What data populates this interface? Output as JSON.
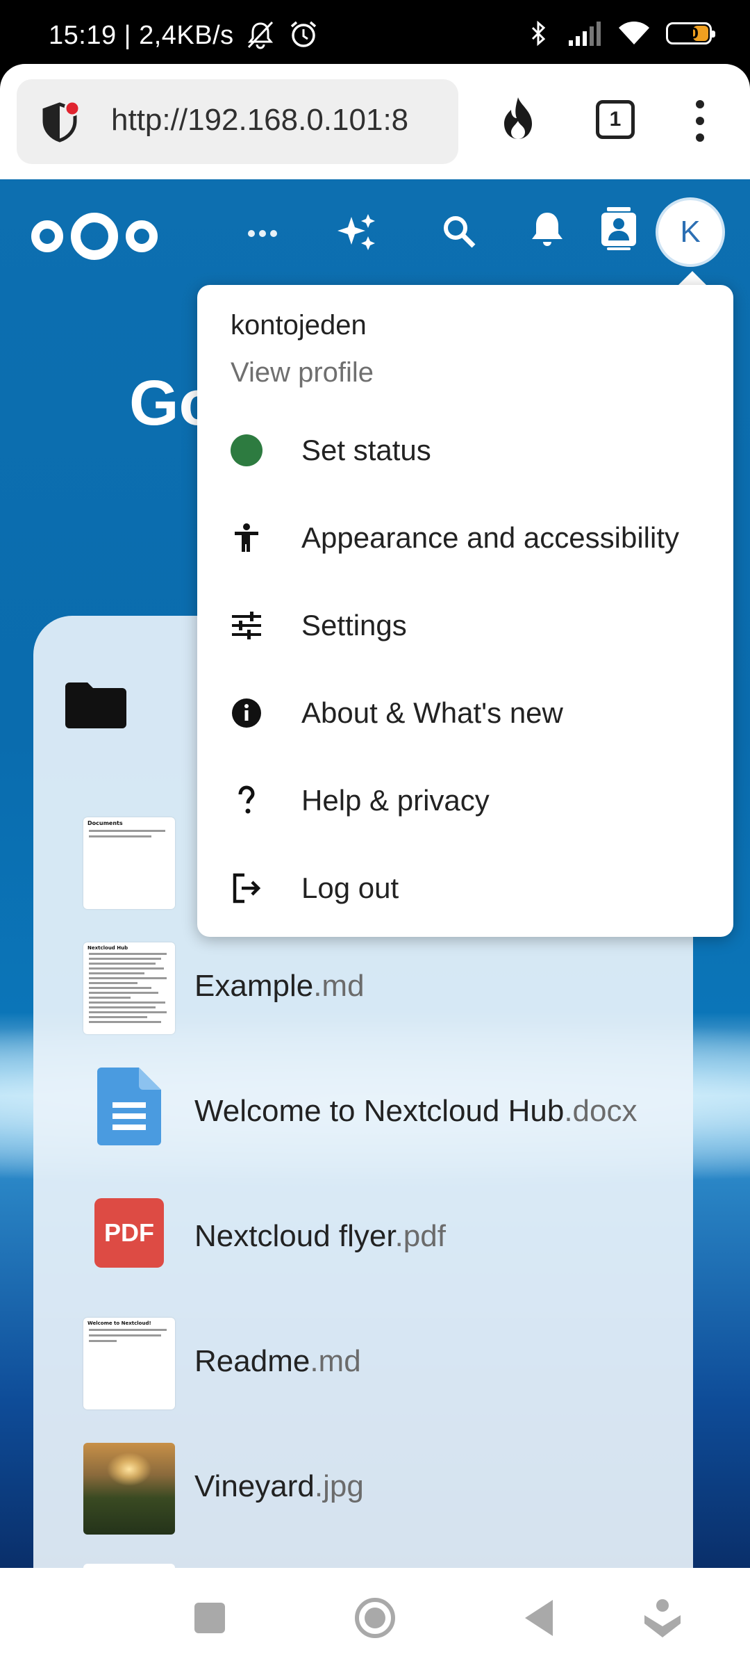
{
  "status_bar": {
    "time": "15:19 | 2,4KB/s",
    "battery_percent": "40",
    "icons": [
      "bell-off-icon",
      "alarm-icon",
      "bluetooth-icon",
      "signal-icon",
      "wifi-icon",
      "battery-icon"
    ]
  },
  "browser": {
    "url": "http://192.168.0.101:8",
    "tab_count": "1",
    "icons": [
      "shield-icon",
      "fire-icon",
      "tabs-icon",
      "more-vertical-icon"
    ]
  },
  "header": {
    "avatar_letter": "K",
    "icons": [
      "nextcloud-logo",
      "more-horizontal-icon",
      "sparkle-icon",
      "search-icon",
      "bell-icon",
      "contacts-icon"
    ]
  },
  "page": {
    "greeting_partial": "Go"
  },
  "menu": {
    "username": "kontojeden",
    "view_profile": "View profile",
    "items": [
      {
        "label": "Set status",
        "icon": "status-dot-icon"
      },
      {
        "label": "Appearance and accessibility",
        "icon": "accessibility-icon"
      },
      {
        "label": "Settings",
        "icon": "sliders-icon"
      },
      {
        "label": "About & What's new",
        "icon": "info-icon"
      },
      {
        "label": "Help & privacy",
        "icon": "question-icon"
      },
      {
        "label": "Log out",
        "icon": "logout-icon"
      }
    ],
    "status_color": "#2d7b40"
  },
  "files": [
    {
      "name": "Example",
      "ext": ".md"
    },
    {
      "name": "Welcome to Nextcloud Hub",
      "ext": ".docx"
    },
    {
      "name": "Nextcloud flyer",
      "ext": ".pdf"
    },
    {
      "name": "Readme",
      "ext": ".md"
    },
    {
      "name": "Vineyard",
      "ext": ".jpg"
    }
  ],
  "thumbnails": {
    "documents_title": "Documents",
    "nextcloud_hub_title": "Nextcloud Hub",
    "welcome_title": "Welcome to Nextcloud!",
    "pdf_label": "PDF"
  },
  "colors": {
    "header_blue": "#0a6cae",
    "accent": "#2c6fb3",
    "pdf_red": "#dd4b44",
    "doc_blue": "#4a9be0"
  }
}
